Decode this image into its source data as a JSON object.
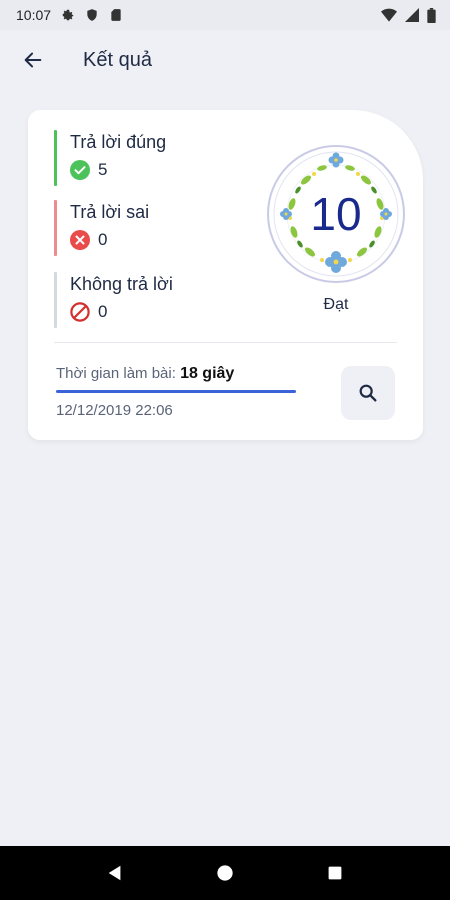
{
  "status_bar": {
    "time": "10:07",
    "icons": [
      "gear-icon",
      "shield-icon",
      "sim-icon",
      "wifi-icon",
      "signal-icon",
      "battery-icon"
    ]
  },
  "app_bar": {
    "title": "Kết quả",
    "back_icon": "arrow-left-icon"
  },
  "results": {
    "correct": {
      "label": "Trả lời đúng",
      "value": "5",
      "icon": "check-circle-icon",
      "color": "#4cc35a"
    },
    "wrong": {
      "label": "Trả lời sai",
      "value": "0",
      "icon": "x-circle-icon",
      "color": "#e94b4b"
    },
    "unanswered": {
      "label": "Không trả lời",
      "value": "0",
      "icon": "prohibited-icon",
      "color": "#d32f2f"
    },
    "score": "10",
    "result_text": "Đạt",
    "duration_label": "Thời gian làm bài:",
    "duration_value": "18 giây",
    "duration_progress": 1.0,
    "datetime": "12/12/2019 22:06",
    "search_icon": "search-icon"
  },
  "colors": {
    "accent": "#1a2a8c",
    "background": "#eff0f5",
    "card": "#ffffff"
  },
  "nav_bar": {
    "buttons": [
      "back-triangle-icon",
      "home-circle-icon",
      "recents-square-icon"
    ]
  }
}
